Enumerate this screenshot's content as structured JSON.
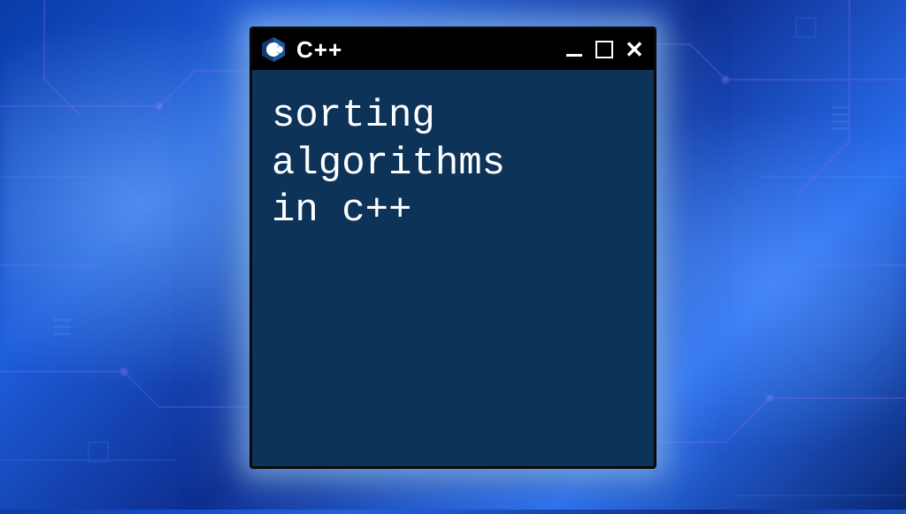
{
  "window": {
    "title": "C++",
    "content_text": "sorting\nalgorithms\nin c++"
  },
  "icons": {
    "app": "cpp-logo",
    "minimize": "minimize-icon",
    "maximize": "maximize-icon",
    "close": "close-icon"
  },
  "colors": {
    "titlebar_bg": "#000000",
    "content_bg": "#0d3359",
    "text": "#ffffff",
    "glow": "#8fc2ff"
  }
}
